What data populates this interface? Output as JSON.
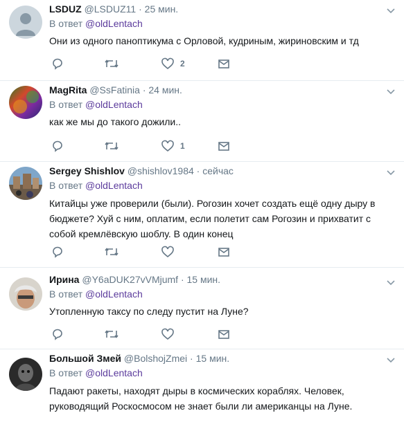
{
  "tweets": [
    {
      "name": "LSDUZ",
      "handle": "@LSDUZ11",
      "time": "25 мин.",
      "reply_prefix": "В ответ",
      "reply_to": "@oldLentach",
      "text": "Они из одного паноптикума с Орловой, кудриным, жириновским и тд",
      "likes": "2",
      "avatar": "default-avatar"
    },
    {
      "name": "MagRita",
      "handle": "@SsFatinia",
      "time": "24 мин.",
      "reply_prefix": "В ответ",
      "reply_to": "@oldLentach",
      "text": "как же мы до такого дожили..",
      "likes": "1",
      "avatar": "colorful-avatar"
    },
    {
      "name": "Sergey Shishlov",
      "handle": "@shishlov1984",
      "time": "сейчас",
      "reply_prefix": "В ответ",
      "reply_to": "@oldLentach",
      "text_lines": [
        "Китайцы уже проверили (были). Рогозин хочет создать ещё одну дыру в",
        "бюджете? Хуй с ним, оплатим, если полетит сам Рогозин и прихватит с",
        "собой кремлёвскую шоблу. В один конец"
      ],
      "likes": "",
      "avatar": "city-avatar"
    },
    {
      "name": "Ирина",
      "handle": "@Y6aDUK27vVMjumf",
      "time": "15 мин.",
      "reply_prefix": "В ответ",
      "reply_to": "@oldLentach",
      "text": "Утопленную таксу по следу пустит на Луне?",
      "likes": "",
      "avatar": "face-avatar"
    },
    {
      "name": "Большой Змей",
      "handle": "@BolshojZmei",
      "time": "15 мин.",
      "reply_prefix": "В ответ",
      "reply_to": "@oldLentach",
      "text_lines": [
        "Падают ракеты, находят дыры в космических кораблях. Человек,",
        "руководящий Роскосмосом не знает были ли американцы на Луне."
      ],
      "likes": "",
      "avatar": "dark-avatar"
    }
  ],
  "separator": "·",
  "colors": {
    "name": "#14171a",
    "muted": "#657786",
    "mention": "#5b3b9c",
    "border": "#e6ecf0"
  }
}
